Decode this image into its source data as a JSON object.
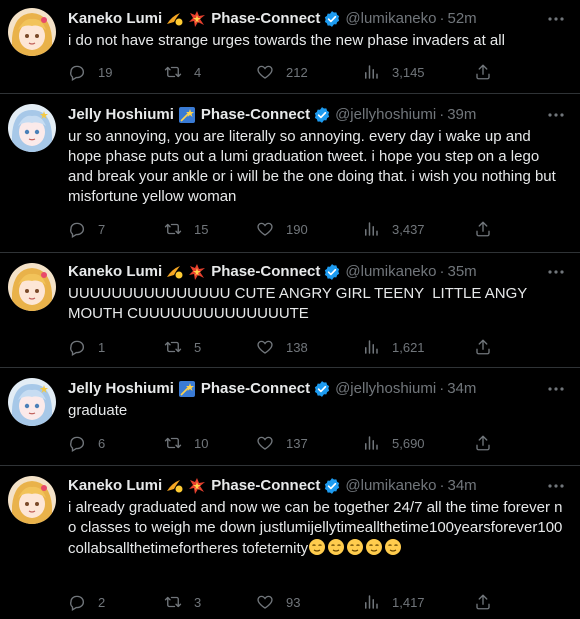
{
  "tweets": [
    {
      "name": "Kaneko Lumi",
      "emojis": [
        "comet",
        "collision"
      ],
      "org": "Phase-Connect",
      "handle": "@lumikaneko",
      "time": "52m",
      "text": "i do not have strange urges towards the new phase invaders at all",
      "reply_count": "19",
      "retweet_count": "4",
      "like_count": "212",
      "view_count": "3,145",
      "avatar": "kaneko-lumi-avatar"
    },
    {
      "name": "Jelly Hoshiumi",
      "emojis": [
        "shooting-star-card"
      ],
      "org": "Phase-Connect",
      "handle": "@jellyhoshiumi",
      "time": "39m",
      "text": "ur so annoying, you are literally so annoying. every day i wake up and hope phase puts out a lumi graduation tweet. i hope you step on a lego and break your ankle or i will be the one doing that. i wish you nothing but misfortune yellow woman",
      "reply_count": "7",
      "retweet_count": "15",
      "like_count": "190",
      "view_count": "3,437",
      "avatar": "jelly-hoshiumi-avatar"
    },
    {
      "name": "Kaneko Lumi",
      "emojis": [
        "comet",
        "collision"
      ],
      "org": "Phase-Connect",
      "handle": "@lumikaneko",
      "time": "35m",
      "text": "UUUUUUUUUUUUUUU CUTE ANGRY GIRL TEENY  LITTLE ANGY MOUTH CUUUUUUUUUUUUUUTE",
      "reply_count": "1",
      "retweet_count": "5",
      "like_count": "138",
      "view_count": "1,621",
      "avatar": "kaneko-lumi-avatar"
    },
    {
      "name": "Jelly Hoshiumi",
      "emojis": [
        "shooting-star-card"
      ],
      "org": "Phase-Connect",
      "handle": "@jellyhoshiumi",
      "time": "34m",
      "text": "graduate",
      "reply_count": "6",
      "retweet_count": "10",
      "like_count": "137",
      "view_count": "5,690",
      "avatar": "jelly-hoshiumi-avatar"
    },
    {
      "name": "Kaneko Lumi",
      "emojis": [
        "comet",
        "collision"
      ],
      "org": "Phase-Connect",
      "handle": "@lumikaneko",
      "time": "34m",
      "text": "i already graduated and now we can be together 24/7 all the time forever no classes to weigh me down justlumijellytimeallthetime100yearsforever100collabsallthetimefortheres tofeternity",
      "text_emojis": [
        "relieved-face",
        "relieved-face",
        "relieved-face",
        "relieved-face",
        "relieved-face"
      ],
      "reply_count": "2",
      "retweet_count": "3",
      "like_count": "93",
      "view_count": "1,417",
      "avatar": "kaneko-lumi-avatar"
    }
  ],
  "colors": {
    "background": "#000000",
    "text": "#e7e9ea",
    "secondary": "#71767b",
    "divider": "#2f3336",
    "verified": "#1d9bf0"
  }
}
